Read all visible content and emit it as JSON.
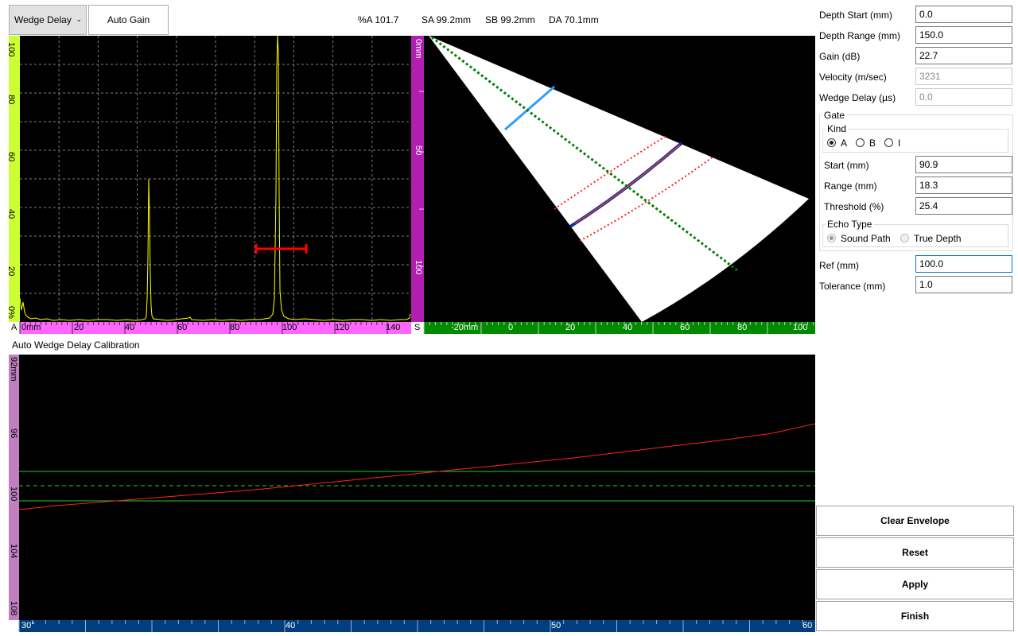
{
  "toolbar": {
    "mode_select": "Wedge Delay",
    "auto_gain_label": "Auto Gain"
  },
  "readouts": {
    "pct_a": "%A 101.7",
    "sa": "SA 99.2mm",
    "sb": "SB 99.2mm",
    "da": "DA 70.1mm"
  },
  "ascan": {
    "channel_letter": "A",
    "y_ticks": [
      "100",
      "80",
      "60",
      "40",
      "20",
      "0%"
    ],
    "x_ticks": [
      "0mm",
      "20",
      "40",
      "60",
      "80",
      "100",
      "120",
      "140"
    ],
    "colors": {
      "signal": "#ffff00",
      "gate": "#ff0000",
      "y_ruler": "#ccff33",
      "x_ruler": "#ff66ff"
    }
  },
  "sscan": {
    "channel_letter": "S",
    "depth_ticks": [
      "0mm",
      "50",
      "100"
    ],
    "x_ticks": [
      "-20mm",
      "0",
      "20",
      "40",
      "60",
      "80",
      "100"
    ],
    "colors": {
      "depth_ruler": "#b01fb0",
      "x_ruler": "#008a00",
      "cursor": "#008000",
      "gate_lines": "#ff0000"
    }
  },
  "calibration": {
    "title": "Auto Wedge Delay Calibration",
    "y_ticks": [
      "92mm",
      "96",
      "100",
      "104",
      "108"
    ],
    "x_ticks": [
      "30°",
      "40",
      "50",
      "60"
    ],
    "colors": {
      "curve": "#ff2020",
      "tolerance": "#22cc22",
      "y_ruler": "#c080c0",
      "x_ruler": "#003e7e"
    }
  },
  "params": {
    "depth_start_label": "Depth Start (mm)",
    "depth_start": "0.0",
    "depth_range_label": "Depth Range (mm)",
    "depth_range": "150.0",
    "gain_label": "Gain (dB)",
    "gain": "22.7",
    "velocity_label": "Velocity (m/sec)",
    "velocity": "3231",
    "wedge_delay_label": "Wedge Delay (µs)",
    "wedge_delay": "0.0"
  },
  "gate": {
    "title": "Gate",
    "kind_title": "Kind",
    "kind_options": [
      "A",
      "B",
      "I"
    ],
    "start_label": "Start (mm)",
    "start": "90.9",
    "range_label": "Range (mm)",
    "range": "18.3",
    "threshold_label": "Threshold (%)",
    "threshold": "25.4",
    "echo_title": "Echo Type",
    "echo_options": [
      "Sound Path",
      "True Depth"
    ]
  },
  "ref": {
    "ref_label": "Ref (mm)",
    "ref_value": "100.0",
    "tol_label": "Tolerance (mm)",
    "tol_value": "1.0"
  },
  "actions": {
    "clear_envelope": "Clear Envelope",
    "reset": "Reset",
    "apply": "Apply",
    "finish": "Finish"
  }
}
